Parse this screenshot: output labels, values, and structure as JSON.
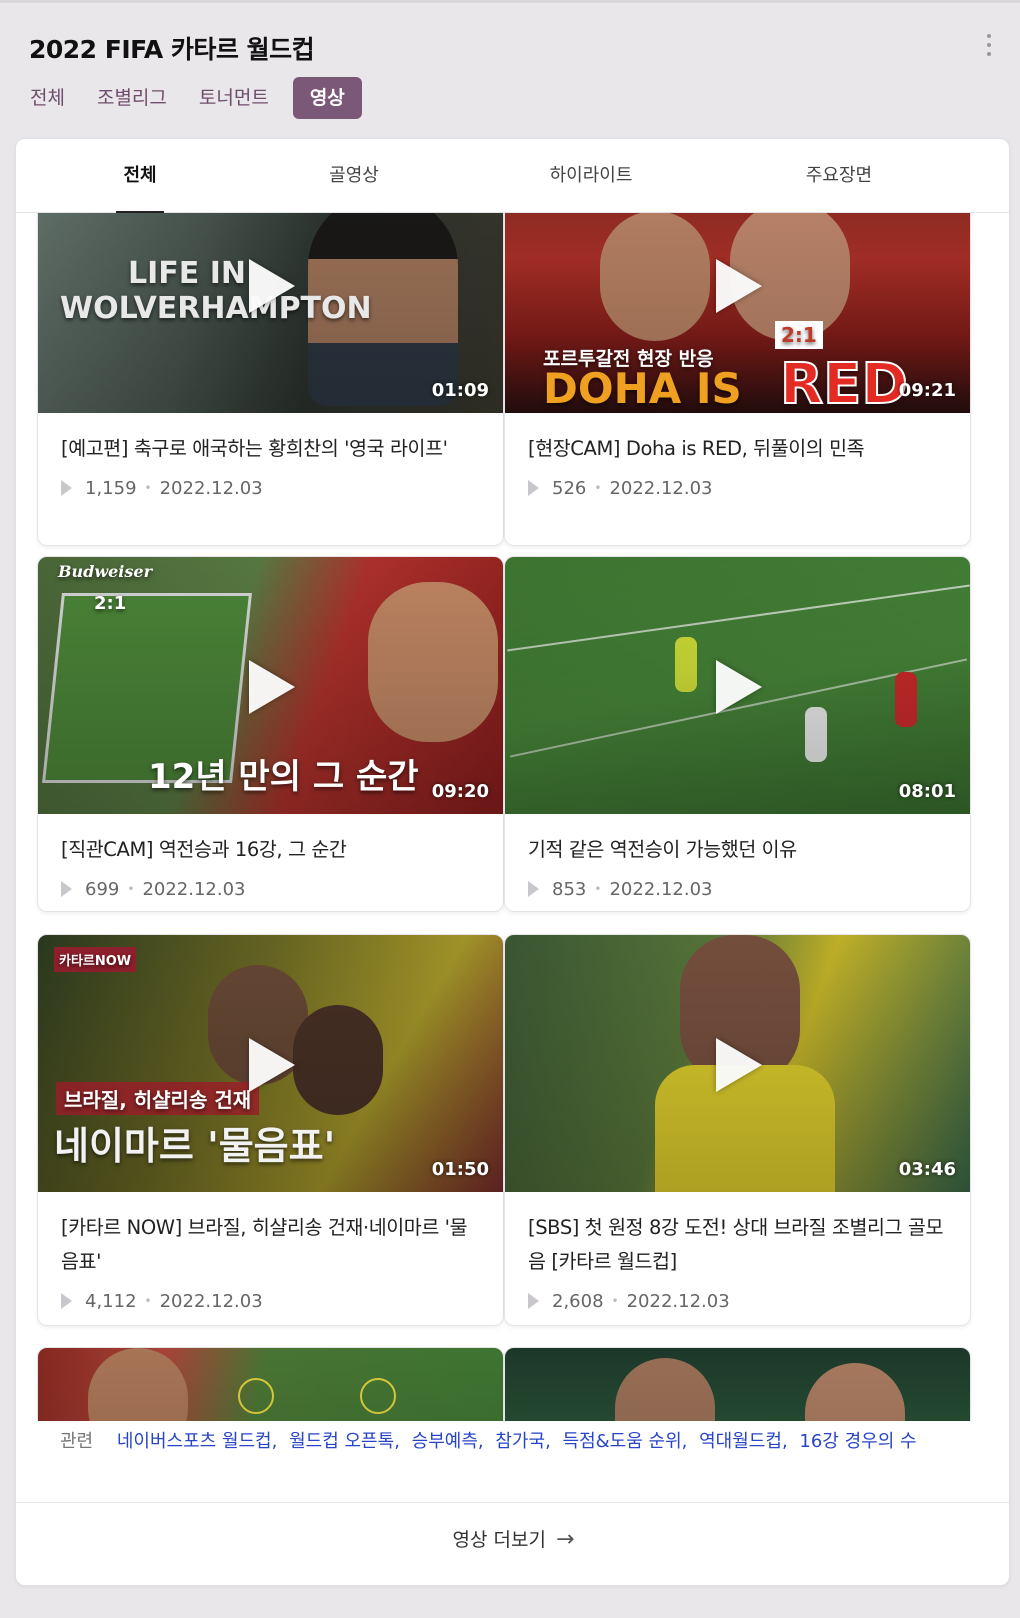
{
  "header": {
    "title": "2022 FIFA 카타르 월드컵",
    "tabs": [
      "전체",
      "조별리그",
      "토너먼트",
      "영상"
    ],
    "active_tab": "영상"
  },
  "subtabs": {
    "items": [
      "전체",
      "골영상",
      "하이라이트",
      "주요장면"
    ],
    "active": "전체"
  },
  "videos": [
    {
      "title": "[예고편] 축구로 애국하는 황희찬의 '영국 라이프'",
      "duration": "01:09",
      "views": "1,159",
      "date": "2022.12.03",
      "thumb_text": [
        "LIFE IN",
        "WOLVERHAMPTON"
      ]
    },
    {
      "title": "[현장CAM] Doha is RED, 뒤풀이의 민족",
      "duration": "09:21",
      "views": "526",
      "date": "2022.12.03",
      "thumb_text": [
        "포르투갈전 현장 반응",
        "DOHA IS",
        "RED",
        "2:1"
      ]
    },
    {
      "title": "[직관CAM] 역전승과 16강, 그 순간",
      "duration": "09:20",
      "views": "699",
      "date": "2022.12.03",
      "thumb_text": [
        "Budweiser",
        "2:1",
        "12년 만의 그 순간"
      ]
    },
    {
      "title": "기적 같은 역전승이 가능했던 이유",
      "duration": "08:01",
      "views": "853",
      "date": "2022.12.03",
      "thumb_text": []
    },
    {
      "title": "[카타르 NOW] 브라질, 히샬리송 건재·네이마르 '물음표'",
      "duration": "01:50",
      "views": "4,112",
      "date": "2022.12.03",
      "thumb_text": [
        "카타르NOW",
        "브라질, 히샬리송 건재",
        "네이마르 '물음표'"
      ]
    },
    {
      "title": "[SBS] 첫 원정 8강 도전! 상대 브라질 조별리그 골모음 [카타르 월드컵]",
      "duration": "03:46",
      "views": "2,608",
      "date": "2022.12.03",
      "thumb_text": []
    }
  ],
  "related": {
    "label": "관련",
    "keywords": [
      "네이버스포츠 월드컵",
      "월드컵 오픈톡",
      "승부예측",
      "참가국",
      "득점&도움 순위",
      "역대월드컵",
      "16강 경우의 수"
    ]
  },
  "more_button": {
    "label": "영상 더보기",
    "arrow": "→"
  },
  "colors": {
    "accent": "#7c5878",
    "link": "#2845c8",
    "background": "#e9e7ea"
  }
}
